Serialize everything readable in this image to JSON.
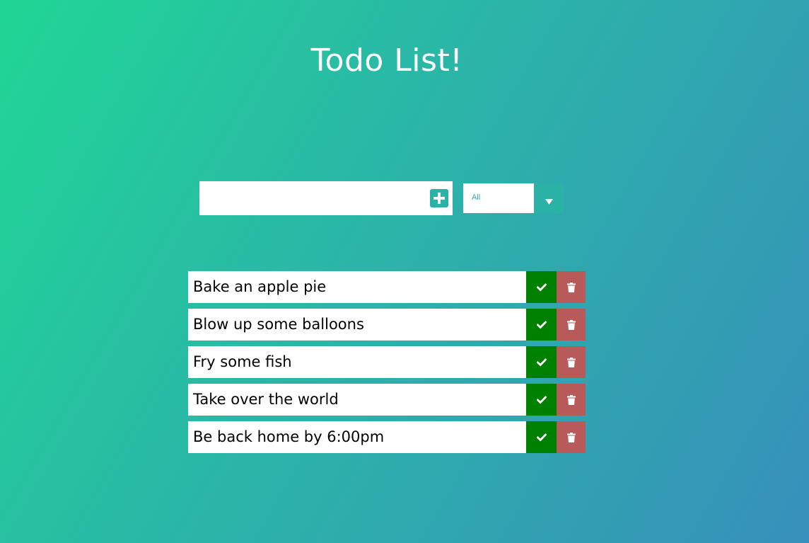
{
  "header": {
    "title": "Todo List!"
  },
  "form": {
    "input_value": "",
    "input_placeholder": "",
    "add_icon": "plus-square-icon"
  },
  "filter": {
    "selected": "All",
    "arrow_icon": "caret-down-icon"
  },
  "todos": [
    {
      "text": "Bake an apple pie"
    },
    {
      "text": "Blow up some balloons"
    },
    {
      "text": "Fry some fish"
    },
    {
      "text": "Take over the world"
    },
    {
      "text": "Be back home by 6:00pm"
    }
  ],
  "actions": {
    "complete_icon": "check-icon",
    "delete_icon": "trash-icon"
  },
  "colors": {
    "accent": "#2bb2a7",
    "complete": "#008000",
    "delete": "#b85a5a",
    "gradient_start": "#20d695",
    "gradient_end": "#3790bb"
  }
}
